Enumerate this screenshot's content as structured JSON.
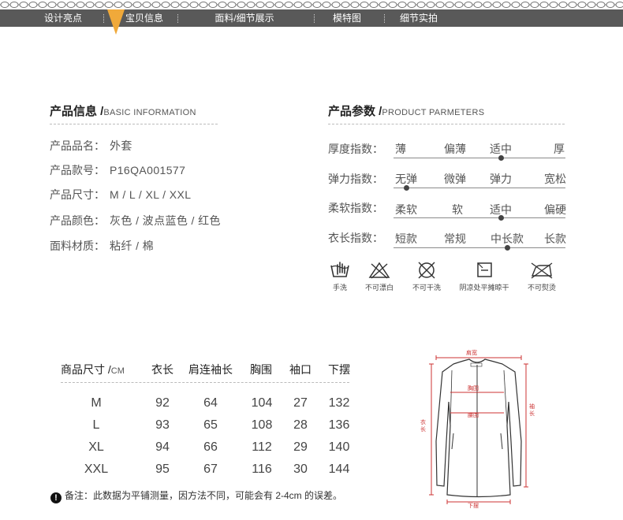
{
  "nav": {
    "items": [
      "设计亮点",
      "宝贝信息",
      "面料/细节展示",
      "模特图",
      "细节实拍"
    ],
    "active_index": 1,
    "accent": "#f0a93a",
    "bar_color": "#595959"
  },
  "basic_info": {
    "title_cn": "产品信息 /",
    "title_en": "BASIC INFORMATION",
    "rows": [
      {
        "label": "产品品名：",
        "value": "外套"
      },
      {
        "label": "产品款号：",
        "value": "P16QA001577"
      },
      {
        "label": "产品尺寸：",
        "value": "M / L / XL / XXL"
      },
      {
        "label": "产品颜色：",
        "value": "灰色 / 波点蓝色 / 红色"
      },
      {
        "label": "面料材质：",
        "value": "粘纤 / 棉"
      }
    ]
  },
  "params": {
    "title_cn": "产品参数 /",
    "title_en": "PRODUCT PARMETERS",
    "rows": [
      {
        "label": "厚度指数：",
        "options": [
          "薄",
          "偏薄",
          "适中",
          "厚"
        ],
        "selected": 2
      },
      {
        "label": "弹力指数：",
        "options": [
          "无弹",
          "微弹",
          "弹力",
          "宽松"
        ],
        "selected": 0
      },
      {
        "label": "柔软指数：",
        "options": [
          "柔软",
          "软",
          "适中",
          "偏硬"
        ],
        "selected": 2
      },
      {
        "label": "衣长指数：",
        "options": [
          "短款",
          "常规",
          "中长款",
          "长款"
        ],
        "selected": 2
      }
    ]
  },
  "care": [
    {
      "icon": "hand-wash-icon",
      "label": "手洗"
    },
    {
      "icon": "no-bleach-icon",
      "label": "不可漂白"
    },
    {
      "icon": "no-dry-clean-icon",
      "label": "不可干洗"
    },
    {
      "icon": "shade-dry-flat-icon",
      "label": "阴凉处平摊晾干"
    },
    {
      "icon": "no-iron-icon",
      "label": "不可熨烫"
    }
  ],
  "size_table": {
    "headers": [
      "商品尺寸 /",
      "衣长",
      "肩连袖长",
      "胸围",
      "袖口",
      "下摆"
    ],
    "unit": "CM",
    "rows": [
      [
        "M",
        "92",
        "64",
        "104",
        "27",
        "132"
      ],
      [
        "L",
        "93",
        "65",
        "108",
        "28",
        "136"
      ],
      [
        "XL",
        "94",
        "66",
        "112",
        "29",
        "140"
      ],
      [
        "XXL",
        "95",
        "67",
        "116",
        "30",
        "144"
      ]
    ],
    "note": "备注：此数据为平铺测量，因方法不同，可能会有 2-4cm 的误差。"
  },
  "diagram": {
    "labels": {
      "shoulder": "肩宽",
      "chest": "胸围",
      "waist": "腰围",
      "length": "衣长",
      "sleeve": "袖长",
      "hem": "下摆"
    },
    "line_color": "#c33"
  }
}
